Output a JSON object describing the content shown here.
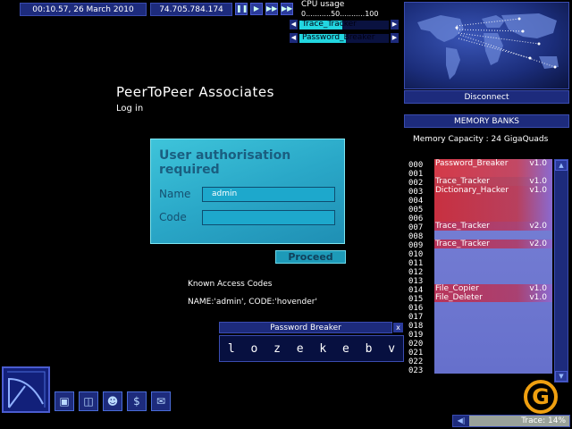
{
  "topbar": {
    "datetime": "00:10.57, 26 March 2010",
    "ip": "74.705.784.174",
    "buttons": [
      "pause-icon",
      "play-icon",
      "fast-forward-icon",
      "skip-icon"
    ]
  },
  "cpu": {
    "label": "CPU usage",
    "scale": "0...........50...........100",
    "tasks": [
      {
        "name": "Trace_Tracker",
        "usage": 0.48
      },
      {
        "name": "Password_Breaker",
        "usage": 0.52
      }
    ]
  },
  "map": {
    "disconnect_label": "Disconnect"
  },
  "site": {
    "title": "PeerToPeer Associates",
    "subtitle": "Log in"
  },
  "auth": {
    "title": "User authorisation required",
    "name_label": "Name",
    "name_value": "admin",
    "code_label": "Code",
    "code_value": "",
    "proceed_label": "Proceed"
  },
  "known": {
    "title": "Known Access Codes",
    "codes": "NAME:'admin', CODE:'hovender'"
  },
  "password_breaker": {
    "title": "Password Breaker",
    "close_label": "x",
    "chars": [
      "l",
      "o",
      "z",
      "e",
      "k",
      "e",
      "b",
      "v"
    ]
  },
  "memory": {
    "header": "MEMORY BANKS",
    "capacity": "Memory Capacity : 24 GigaQuads",
    "slots": [
      "000",
      "001",
      "002",
      "003",
      "004",
      "005",
      "006",
      "007",
      "008",
      "009",
      "010",
      "011",
      "012",
      "013",
      "014",
      "015",
      "016",
      "017",
      "018",
      "019",
      "020",
      "021",
      "022",
      "023"
    ],
    "files": [
      {
        "slot": 0,
        "span": 2,
        "name": "Password_Breaker",
        "version": "v1.0",
        "color": "#d43a48"
      },
      {
        "slot": 2,
        "span": 1,
        "name": "Trace_Tracker",
        "version": "v1.0",
        "color": "#c23848"
      },
      {
        "slot": 3,
        "span": 4,
        "name": "Dictionary_Hacker",
        "version": "v1.0",
        "color": "#c83040"
      },
      {
        "slot": 7,
        "span": 1,
        "name": "Trace_Tracker",
        "version": "v2.0",
        "color": "#b8345a"
      },
      {
        "slot": 9,
        "span": 1,
        "name": "Trace_Tracker",
        "version": "v2.0",
        "color": "#b8345a"
      },
      {
        "slot": 14,
        "span": 1,
        "name": "File_Copier",
        "version": "v1.0",
        "color": "#b8345a"
      },
      {
        "slot": 15,
        "span": 1,
        "name": "File_Deleter",
        "version": "v1.0",
        "color": "#b8345a"
      }
    ]
  },
  "trace": {
    "label": "Trace: 14%",
    "value": 0.14
  },
  "colors": {
    "panel": "#1d2b7c",
    "accent": "#22d6e0",
    "auth_panel": "#2aa8c8",
    "file_red": "#c83040",
    "logo": "#f0a010"
  }
}
